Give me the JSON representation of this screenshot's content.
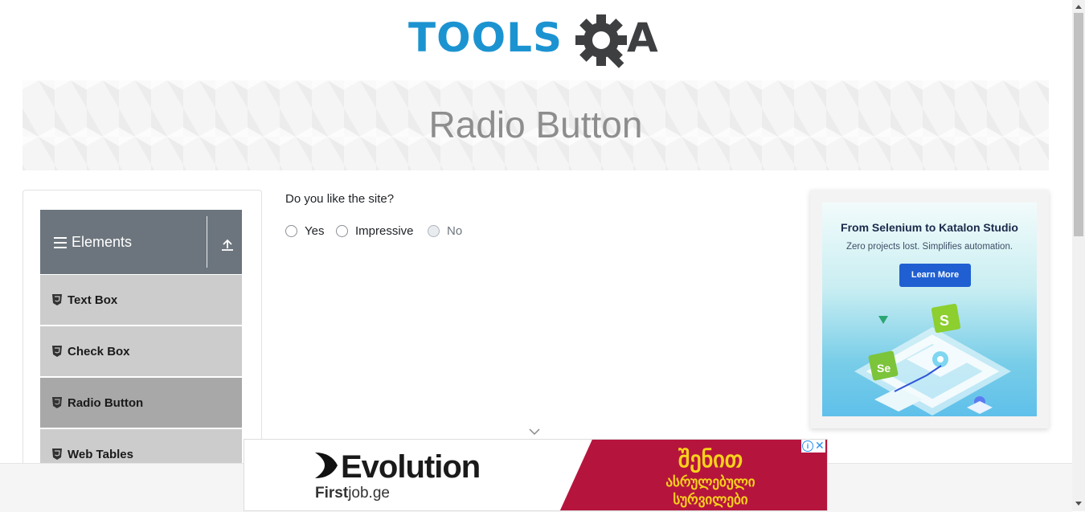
{
  "header": {
    "logo_text": "TOOLS",
    "logo_suffix": "A"
  },
  "banner": {
    "title": "Radio Button"
  },
  "sidebar": {
    "group_label": "Elements",
    "items": [
      {
        "label": "Text Box"
      },
      {
        "label": "Check Box"
      },
      {
        "label": "Radio Button"
      },
      {
        "label": "Web Tables"
      }
    ]
  },
  "main": {
    "question": "Do you like the site?",
    "options": [
      {
        "label": "Yes",
        "disabled": false
      },
      {
        "label": "Impressive",
        "disabled": false
      },
      {
        "label": "No",
        "disabled": true
      }
    ]
  },
  "right_ad": {
    "title": "From Selenium to Katalon Studio",
    "subtitle": "Zero projects lost. Simplifies automation.",
    "button": "Learn More"
  },
  "bottom_ad": {
    "brand": "Evolution",
    "site_prefix": "First",
    "site_suffix": "job.ge",
    "geo_line1": "შენით",
    "geo_line2": "ასრულებული",
    "geo_line3": "სურვილები"
  },
  "colors": {
    "brand_blue": "#1c93d1",
    "group_header": "#6c757d",
    "active_item": "#a8a8a8",
    "ad_red": "#b5153d"
  }
}
